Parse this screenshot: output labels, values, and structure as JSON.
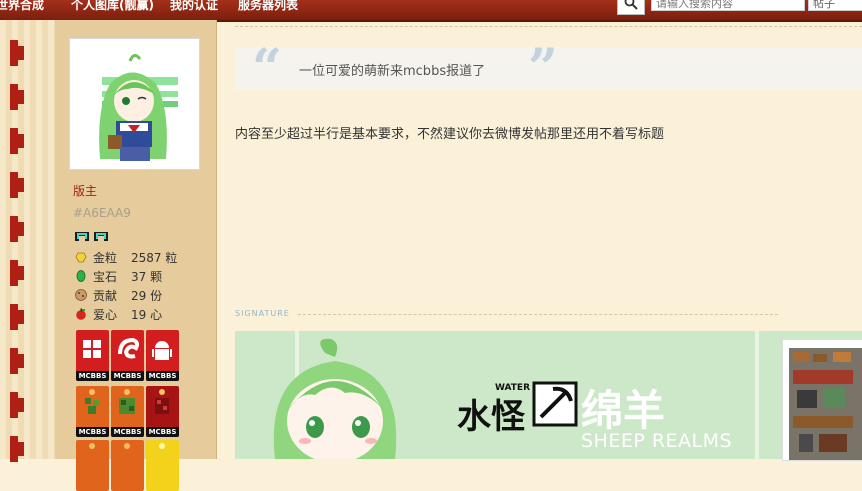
{
  "nav": {
    "items": [
      "世界合成",
      "个人图库(靓赢)",
      "我的认证",
      "服务器列表"
    ],
    "search_placeholder": "请输入搜索内容",
    "search_type": "帖子"
  },
  "profile": {
    "role": "版主",
    "uid": "#A6EAA9",
    "stats": [
      {
        "label": "金粒",
        "value": "2587 粒",
        "icon": "gold-nugget-icon",
        "color": "#f2d33a"
      },
      {
        "label": "宝石",
        "value": "37 颗",
        "icon": "emerald-icon",
        "color": "#2fb24a"
      },
      {
        "label": "贡献",
        "value": "29 份",
        "icon": "cookie-icon",
        "color": "#b78a5a"
      },
      {
        "label": "爱心",
        "value": "19 心",
        "icon": "apple-icon",
        "color": "#d8251c"
      }
    ],
    "badge_label": "MCBBS"
  },
  "post": {
    "quote": "一位可爱的萌新来mcbbs报道了",
    "body": "内容至少超过半行是基本要求，不然建议你去微博发帖那里还用不着写标题",
    "signature_label": "SIGNATURE"
  },
  "signature": {
    "water": "WATER",
    "title_left": "水怪",
    "title_right": "绵羊",
    "subtitle": "SHEEP REALMS"
  },
  "colors": {
    "nav_bg": "#8e2612",
    "sidebar_bg": "#e6cb9c",
    "page_bg": "#fbf1d9",
    "role_color": "#a0231a",
    "banner_bg": "#cde8c9"
  }
}
